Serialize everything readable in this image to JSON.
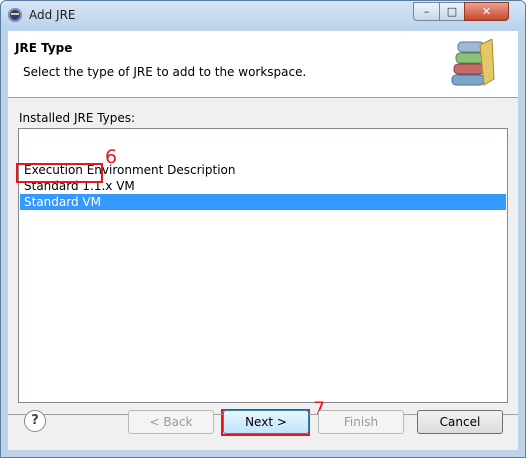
{
  "window": {
    "title": "Add JRE"
  },
  "header": {
    "title": "JRE Type",
    "description": "Select the type of JRE to add to the workspace."
  },
  "list": {
    "label": "Installed JRE Types:",
    "items": [
      {
        "label": "Execution Environment Description",
        "selected": false
      },
      {
        "label": "Standard 1.1.x VM",
        "selected": false
      },
      {
        "label": "Standard VM",
        "selected": true
      }
    ]
  },
  "annotations": [
    {
      "label": "6"
    },
    {
      "label": "7"
    }
  ],
  "buttons": {
    "help": "?",
    "back": "< Back",
    "next": "Next >",
    "finish": "Finish",
    "cancel": "Cancel"
  },
  "colors": {
    "selection": "#3399ff",
    "annotation": "#e8161d"
  }
}
